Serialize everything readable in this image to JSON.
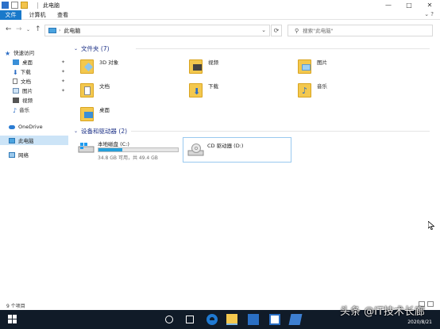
{
  "window": {
    "title": "此电脑",
    "controls": {
      "minimize": "—",
      "maximize": "□",
      "close": "✕"
    }
  },
  "ribbon": {
    "tabs": [
      "文件",
      "计算机",
      "查看"
    ],
    "expand_icon": "chevron-down-icon"
  },
  "address": {
    "crumb": "此电脑",
    "search_placeholder": "搜索\"此电脑\""
  },
  "sidebar": {
    "items": [
      {
        "label": "快速访问",
        "icon": "star-icon",
        "pinned": false
      },
      {
        "label": "桌面",
        "icon": "desktop-icon",
        "pinned": true
      },
      {
        "label": "下载",
        "icon": "download-icon",
        "pinned": true
      },
      {
        "label": "文档",
        "icon": "document-icon",
        "pinned": true
      },
      {
        "label": "图片",
        "icon": "picture-icon",
        "pinned": true
      },
      {
        "label": "视频",
        "icon": "video-icon",
        "pinned": false
      },
      {
        "label": "音乐",
        "icon": "music-icon",
        "pinned": false
      },
      {
        "label": "OneDrive",
        "icon": "cloud-icon",
        "pinned": false
      },
      {
        "label": "此电脑",
        "icon": "pc-icon",
        "pinned": false,
        "selected": true
      },
      {
        "label": "网络",
        "icon": "network-icon",
        "pinned": false
      }
    ]
  },
  "folders_group": {
    "title": "文件夹 (7)",
    "items": [
      {
        "name": "3D 对象",
        "overlay": "cube"
      },
      {
        "name": "视频",
        "overlay": "film"
      },
      {
        "name": "图片",
        "overlay": "picture"
      },
      {
        "name": "文档",
        "overlay": "doc"
      },
      {
        "name": "下载",
        "overlay": "download"
      },
      {
        "name": "音乐",
        "overlay": "music"
      },
      {
        "name": "桌面",
        "overlay": "desktop"
      }
    ]
  },
  "drives_group": {
    "title": "设备和驱动器 (2)",
    "items": [
      {
        "name": "本地磁盘 (C:)",
        "free_text": "34.8 GB 可用，共 49.4 GB",
        "used_fraction": 0.3
      },
      {
        "name": "CD 驱动器 (D:)"
      }
    ]
  },
  "status": {
    "count": "9 个项目"
  },
  "taskbar": {
    "date": "2020/8/21",
    "watermark": "头条 @IT技术长廊"
  },
  "colors": {
    "accent": "#1979ca",
    "selected_bg": "#cce4f7",
    "progress": "#26a0da",
    "folder": "#f3c84e",
    "taskbar": "#101b28"
  }
}
